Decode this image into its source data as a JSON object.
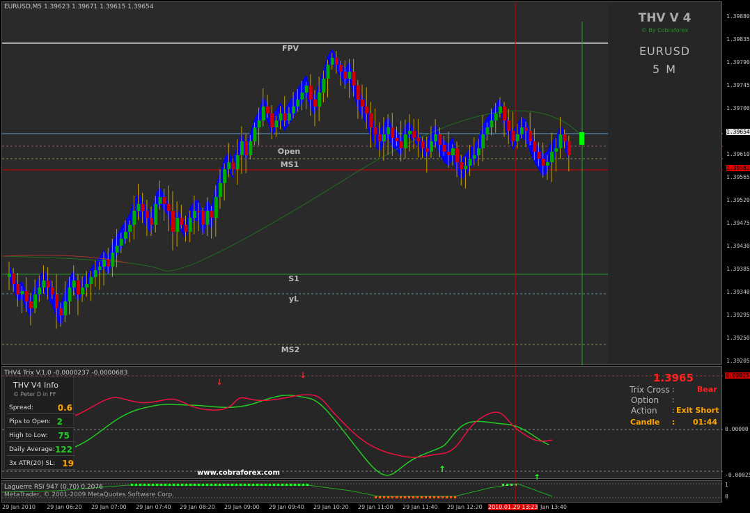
{
  "header": {
    "symbol_line": "EURUSD,M5  1.39623 1.39671 1.39615 1.39654"
  },
  "thv": {
    "title": "THV V 4",
    "byline": "© By Cobraforex",
    "pair": "EURUSD",
    "timeframe": "5 M"
  },
  "chart_levels": {
    "fpv": "FPV",
    "open": "Open",
    "ms1": "MS1",
    "s1": "S1",
    "yl": "yL",
    "ms2": "MS2"
  },
  "price_scale": [
    "1.39880",
    "1.39835",
    "1.39790",
    "1.39745",
    "1.39700",
    "1.39654",
    "1.39610",
    "1.39582",
    "1.39565",
    "1.39520",
    "1.39475",
    "1.39430",
    "1.39385",
    "1.39340",
    "1.39295",
    "1.39250",
    "1.39205"
  ],
  "current_price": "1.39654",
  "red_line_price": "1.39582",
  "trix": {
    "title": "THV4 Trix V.1.0 -0.0000237 -0.0000683",
    "scale_top": "0.00025",
    "scale_mid": "0.00000",
    "scale_bot": "-0.00025",
    "website": "www.cobraforex.com"
  },
  "info": {
    "title": "THV  V4  Info",
    "author": "© Peter D  in FF",
    "rows": [
      {
        "label": "Spread:",
        "value": "0.6",
        "color": "#ffa500"
      },
      {
        "label": "Pips to Open:",
        "value": "2",
        "color": "#22cc22"
      },
      {
        "label": "High to Low:",
        "value": "75",
        "color": "#22cc22"
      },
      {
        "label": "Daily Average:",
        "value": "122",
        "color": "#22cc22"
      },
      {
        "label": "3x ATR(20) SL:",
        "value": "19",
        "color": "#ffa500"
      }
    ]
  },
  "side": {
    "price": "1.3965",
    "trix_cross_label": "Trix Cross",
    "trix_cross_sep": ":",
    "trix_cross_value": "Bear",
    "option_label": "Option",
    "option_sep": ":",
    "action_label": "Action",
    "action_sep": ":",
    "action_value": "Exit Short",
    "candle_label": "Candle",
    "candle_sep": ":",
    "candle_value": "01:44"
  },
  "rsi": {
    "title": "Laguerre RSI 947 (0.70) 0.2076",
    "copyright": "MetaTrader, © 2001-2009 MetaQuotes Software Corp.",
    "scale_top": "1",
    "scale_bot": "0"
  },
  "time_axis": [
    "29 Jan 2010",
    "29 Jan 06:20",
    "29 Jan 07:00",
    "29 Jan 07:40",
    "29 Jan 08:20",
    "29 Jan 09:00",
    "29 Jan 09:40",
    "29 Jan 10:20",
    "29 Jan 11:00",
    "29 Jan 11:40",
    "29 Jan 12:20",
    "2010.01.29 13:23",
    "Jan 13:40"
  ],
  "colors": {
    "bull": "#00aa00",
    "bear": "#cc0000",
    "cloud": "#0000ff",
    "wick": "#c8a000"
  }
}
